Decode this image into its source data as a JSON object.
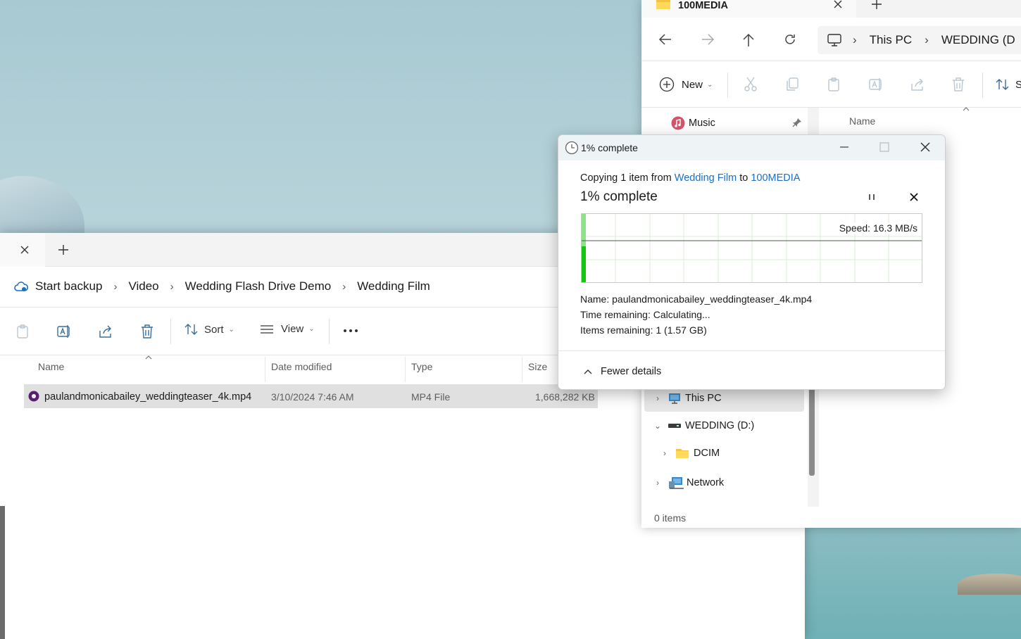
{
  "left_window": {
    "breadcrumbs": [
      "Start backup",
      "Video",
      "Wedding Flash Drive Demo",
      "Wedding Film"
    ],
    "toolbar": {
      "sort_label": "Sort",
      "view_label": "View"
    },
    "columns": [
      "Name",
      "Date modified",
      "Type",
      "Size"
    ],
    "files": [
      {
        "name": "paulandmonicabailey_weddingteaser_4k.mp4",
        "date": "3/10/2024 7:46 AM",
        "type": "MP4 File",
        "size": "1,668,282 KB"
      }
    ]
  },
  "right_window": {
    "tab_title": "100MEDIA",
    "address": [
      "This PC",
      "WEDDING (D"
    ],
    "toolbar": {
      "new_label": "New",
      "sort_label": "S"
    },
    "column_name": "Name",
    "nav": {
      "music": "Music",
      "this_pc": "This PC",
      "wedding": "WEDDING (D:)",
      "dcim": "DCIM",
      "network": "Network"
    },
    "status": "0 items"
  },
  "progress_dialog": {
    "title": "1% complete",
    "copy_prefix": "Copying 1 item from",
    "source": "Wedding Film",
    "to_word": "to",
    "destination": "100MEDIA",
    "headline": "1% complete",
    "progress_fraction": 0.01,
    "speed": "Speed: 16.3 MB/s",
    "name_label": "Name:",
    "name_value": "paulandmonicabailey_weddingteaser_4k.mp4",
    "time_label": "Time remaining:",
    "time_value": "Calculating...",
    "items_label": "Items remaining:",
    "items_value": "1 (1.57 GB)",
    "fewer_details": "Fewer details"
  },
  "colors": {
    "accent_link": "#1a6fc4",
    "progress_green": "#16c60c",
    "title_bar": "#eef4f6"
  }
}
